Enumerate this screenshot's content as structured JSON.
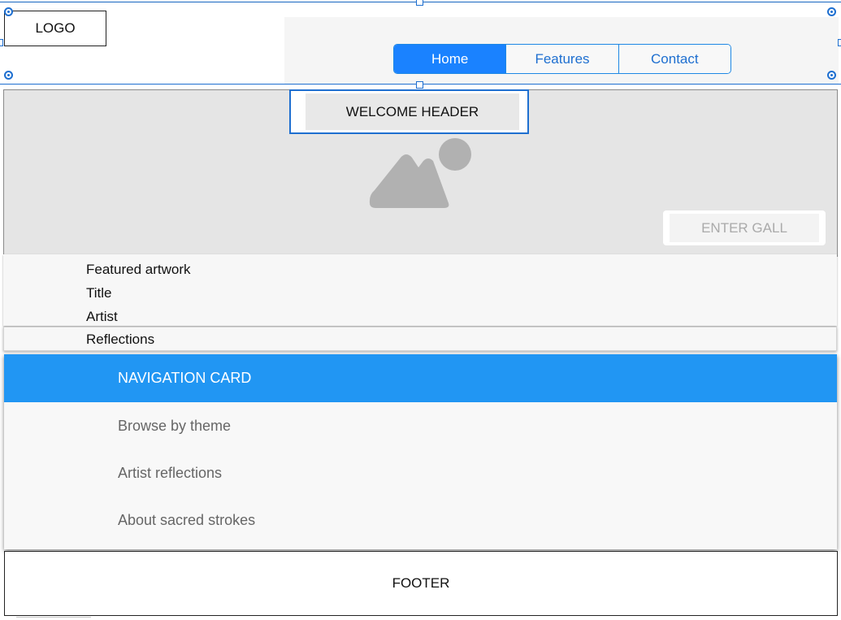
{
  "header": {
    "logo": "LOGO",
    "nav": [
      {
        "label": "Home",
        "active": true
      },
      {
        "label": "Features",
        "active": false
      },
      {
        "label": "Contact",
        "active": false
      }
    ]
  },
  "hero": {
    "welcome": "WELCOME HEADER",
    "image_icon": "image-placeholder-icon",
    "cta": "ENTER GALL"
  },
  "featured": {
    "heading": "Featured artwork",
    "title": "Title",
    "artist": "Artist",
    "reflections": "Reflections"
  },
  "nav_card": {
    "header": "NAVIGATION CARD",
    "items": [
      "Browse by theme",
      "Artist reflections",
      "About sacred strokes"
    ]
  },
  "footer": {
    "label": "FOOTER"
  },
  "colors": {
    "accent": "#1a82ff",
    "card_header": "#2196f3",
    "selection": "#1e6fd0"
  }
}
